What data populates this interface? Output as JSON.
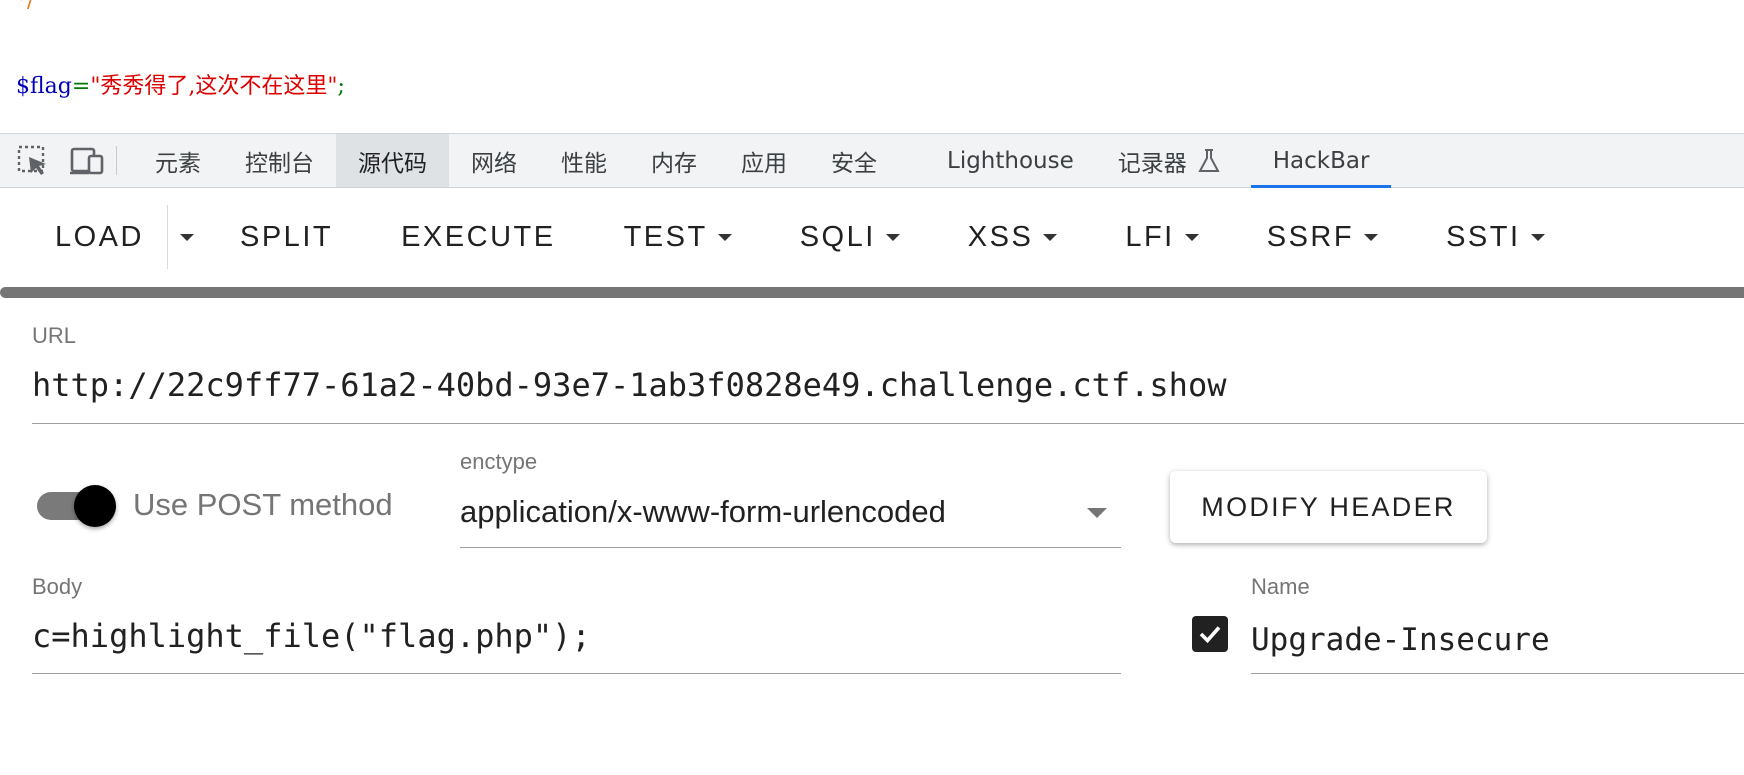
{
  "source": {
    "comment_fragment": "*/",
    "flag_var": "$flag",
    "flag_op": "=",
    "flag_value": "\"秀秀得了,这次不在这里\"",
    "flag_end": ";"
  },
  "devtools": {
    "tabs": [
      {
        "label": "元素"
      },
      {
        "label": "控制台"
      },
      {
        "label": "源代码",
        "active": true
      },
      {
        "label": "网络"
      },
      {
        "label": "性能"
      },
      {
        "label": "内存"
      },
      {
        "label": "应用"
      },
      {
        "label": "安全"
      },
      {
        "label": "Lighthouse"
      },
      {
        "label": "记录器"
      },
      {
        "label": "HackBar",
        "selected": true
      }
    ],
    "icons": [
      "inspect-element-icon",
      "device-toolbar-icon",
      "flask-icon"
    ]
  },
  "hackbar": {
    "toolbar": {
      "load": "LOAD",
      "split": "SPLIT",
      "execute": "EXECUTE",
      "test": "TEST",
      "sqli": "SQLI",
      "xss": "XSS",
      "lfi": "LFI",
      "ssrf": "SSRF",
      "ssti": "SSTI"
    },
    "url_label": "URL",
    "url_value": "http://22c9ff77-61a2-40bd-93e7-1ab3f0828e49.challenge.ctf.show",
    "post_toggle_label": "Use POST method",
    "post_toggle_on": true,
    "enctype_label": "enctype",
    "enctype_value": "application/x-www-form-urlencoded",
    "modify_header": "MODIFY HEADER",
    "body_label": "Body",
    "body_value": "c=highlight_file(\"flag.php\");",
    "header_name_label": "Name",
    "header_name_value": "Upgrade-Insecure",
    "header_checked": true,
    "accent_color": "#1a73e8"
  }
}
